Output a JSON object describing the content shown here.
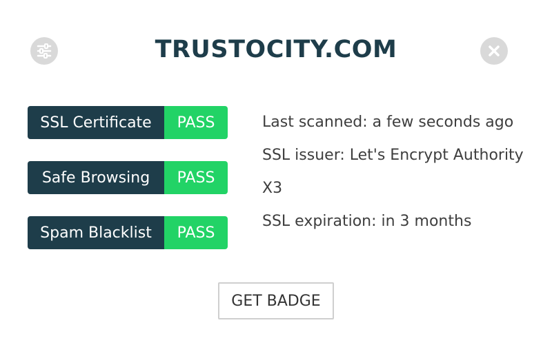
{
  "header": {
    "title": "TRUSTOCITY.COM",
    "settings_icon": "sliders-icon",
    "close_icon": "close-icon"
  },
  "checks": [
    {
      "label": "SSL Certificate",
      "status": "PASS"
    },
    {
      "label": "Safe Browsing",
      "status": "PASS"
    },
    {
      "label": "Spam Blacklist",
      "status": "PASS"
    }
  ],
  "info": {
    "last_scanned": "Last scanned: a few seconds ago",
    "ssl_issuer": "SSL issuer: Let's Encrypt Authority X3",
    "ssl_expiration": "SSL expiration: in 3 months"
  },
  "actions": {
    "get_badge_label": "GET BADGE"
  },
  "colors": {
    "title": "#1e3d4a",
    "label_bg": "#1e3d4a",
    "pass_bg": "#22d366",
    "icon_bg": "#d9d9d9"
  }
}
